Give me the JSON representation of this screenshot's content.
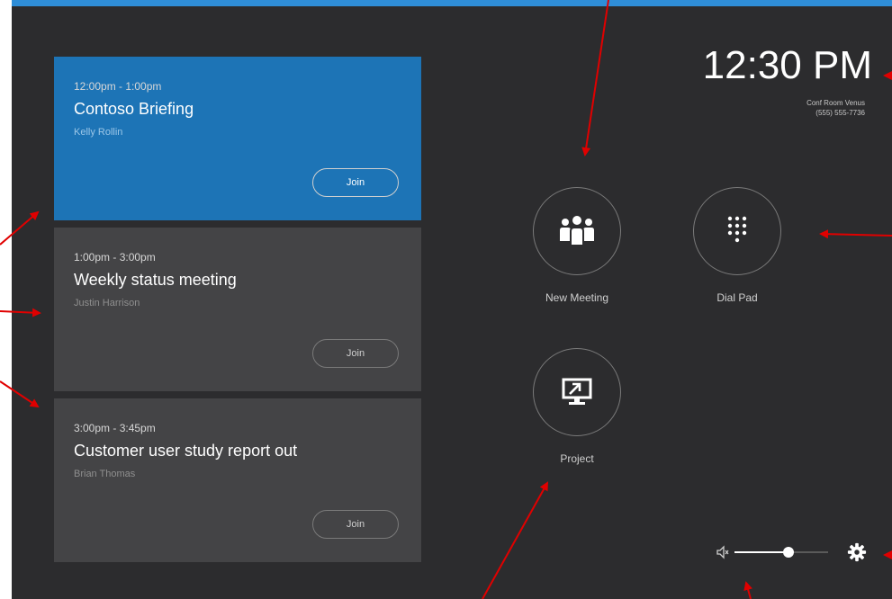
{
  "meetings": [
    {
      "time": "12:00pm - 1:00pm",
      "title": "Contoso Briefing",
      "organizer": "Kelly Rollin",
      "join_label": "Join",
      "active": true
    },
    {
      "time": "1:00pm - 3:00pm",
      "title": "Weekly status meeting",
      "organizer": "Justin Harrison",
      "join_label": "Join",
      "active": false
    },
    {
      "time": "3:00pm - 3:45pm",
      "title": "Customer user study report out",
      "organizer": "Brian Thomas",
      "join_label": "Join",
      "active": false
    }
  ],
  "clock": {
    "time": "12:30 PM",
    "room_name": "Conf Room Venus",
    "room_phone": "(555) 555-7736"
  },
  "actions": {
    "new_meeting_label": "New Meeting",
    "dial_pad_label": "Dial Pad",
    "project_label": "Project"
  },
  "volume": {
    "level": 0.58
  },
  "colors": {
    "background": "#2c2c2e",
    "accent": "#1d74b6",
    "card": "#444446",
    "top_bar": "#2f8ed8",
    "annotation_arrow": "#e00000"
  }
}
